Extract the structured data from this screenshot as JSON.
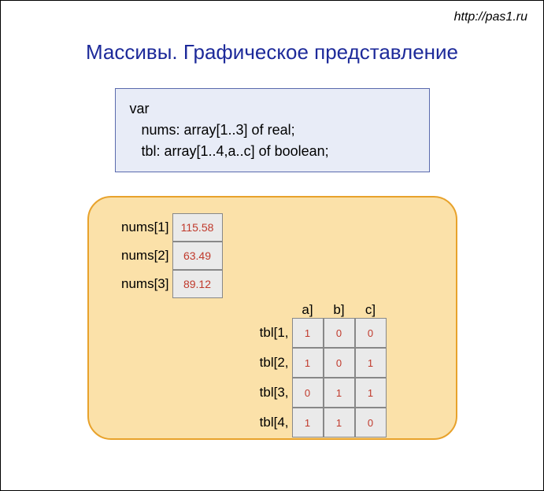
{
  "url": "http://pas1.ru",
  "title": "Массивы. Графическое представление",
  "code": "var\n   nums: array[1..3] of real;\n   tbl: array[1..4,a..c] of boolean;",
  "nums": {
    "labels": [
      "nums[1]",
      "nums[2]",
      "nums[3]"
    ],
    "values": [
      "115.58",
      "63.49",
      "89.12"
    ]
  },
  "tbl": {
    "colHeaders": [
      "a]",
      "b]",
      "c]"
    ],
    "rowLabels": [
      "tbl[1,",
      "tbl[2,",
      "tbl[3,",
      "tbl[4,"
    ],
    "cells": [
      [
        "1",
        "0",
        "0"
      ],
      [
        "1",
        "0",
        "1"
      ],
      [
        "0",
        "1",
        "1"
      ],
      [
        "1",
        "1",
        "0"
      ]
    ]
  }
}
